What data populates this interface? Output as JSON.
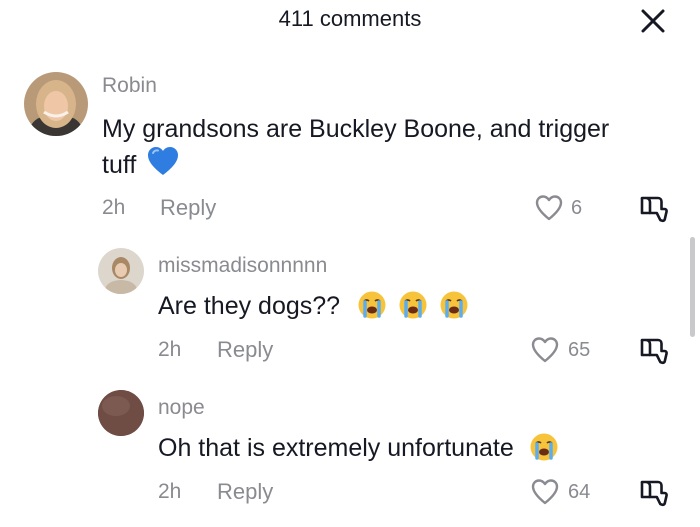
{
  "header": {
    "title": "411 comments",
    "close_icon": "close-x-icon"
  },
  "comments": [
    {
      "username": "Robin",
      "text_line1": "My grandsons are Buckley Boone, and trigger",
      "text_line2": "tuff",
      "emoji": "blue-heart",
      "time": "2h",
      "reply_label": "Reply",
      "likes": "6"
    },
    {
      "username": "missmadisonnnnn",
      "text": "Are they dogs??",
      "emoji": "loudly-crying-face x3",
      "time": "2h",
      "reply_label": "Reply",
      "likes": "65"
    },
    {
      "username": "nope",
      "text": "Oh that is extremely unfortunate",
      "emoji": "loudly-crying-face",
      "time": "2h",
      "reply_label": "Reply",
      "likes": "64"
    }
  ],
  "colors": {
    "muted": "#8a8b91",
    "text": "#161823",
    "heart_blue": "#2f7de1",
    "emoji_yellow": "#f6c33b"
  }
}
